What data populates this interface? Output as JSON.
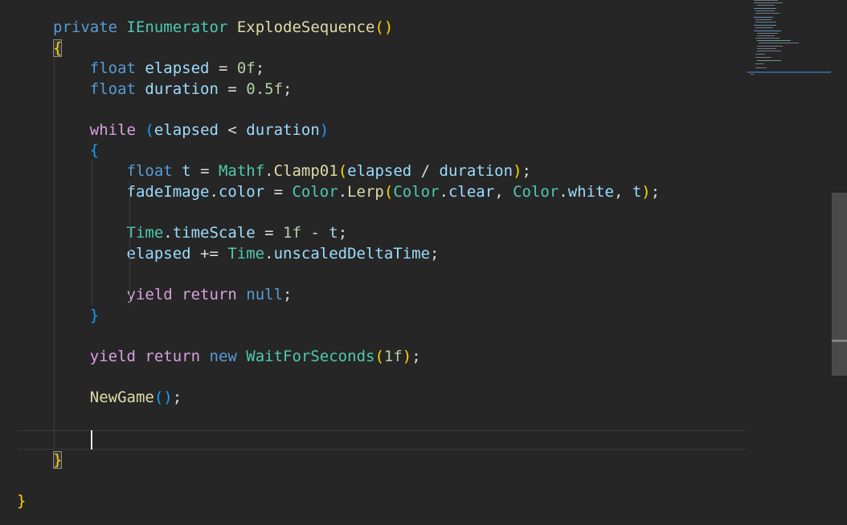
{
  "editor": {
    "lines": [
      {
        "tokens": [
          {
            "t": "private",
            "c": "kw"
          },
          {
            "t": " "
          },
          {
            "t": "IEnumerator",
            "c": "type"
          },
          {
            "t": " "
          },
          {
            "t": "ExplodeSequence",
            "c": "method"
          },
          {
            "t": "()",
            "c": "b1"
          }
        ]
      },
      {
        "tokens": [
          {
            "t": "{",
            "c": "b1 brace-hl"
          }
        ]
      },
      {
        "tokens": [
          {
            "t": "    "
          },
          {
            "t": "float",
            "c": "kw"
          },
          {
            "t": " "
          },
          {
            "t": "elapsed",
            "c": "ident"
          },
          {
            "t": " = "
          },
          {
            "t": "0f",
            "c": "num"
          },
          {
            "t": ";"
          }
        ]
      },
      {
        "tokens": [
          {
            "t": "    "
          },
          {
            "t": "float",
            "c": "kw"
          },
          {
            "t": " "
          },
          {
            "t": "duration",
            "c": "ident"
          },
          {
            "t": " = "
          },
          {
            "t": "0.5f",
            "c": "num"
          },
          {
            "t": ";"
          }
        ]
      },
      {
        "tokens": []
      },
      {
        "tokens": [
          {
            "t": "    "
          },
          {
            "t": "while",
            "c": "kw2"
          },
          {
            "t": " "
          },
          {
            "t": "(",
            "c": "b3"
          },
          {
            "t": "elapsed",
            "c": "ident"
          },
          {
            "t": " < "
          },
          {
            "t": "duration",
            "c": "ident"
          },
          {
            "t": ")",
            "c": "b3"
          }
        ]
      },
      {
        "tokens": [
          {
            "t": "    "
          },
          {
            "t": "{",
            "c": "b3"
          }
        ]
      },
      {
        "tokens": [
          {
            "t": "        "
          },
          {
            "t": "float",
            "c": "kw"
          },
          {
            "t": " "
          },
          {
            "t": "t",
            "c": "ident"
          },
          {
            "t": " = "
          },
          {
            "t": "Mathf",
            "c": "type"
          },
          {
            "t": "."
          },
          {
            "t": "Clamp01",
            "c": "method"
          },
          {
            "t": "(",
            "c": "b1"
          },
          {
            "t": "elapsed",
            "c": "ident"
          },
          {
            "t": " / "
          },
          {
            "t": "duration",
            "c": "ident"
          },
          {
            "t": ")",
            "c": "b1"
          },
          {
            "t": ";"
          }
        ]
      },
      {
        "tokens": [
          {
            "t": "        "
          },
          {
            "t": "fadeImage",
            "c": "ident"
          },
          {
            "t": "."
          },
          {
            "t": "color",
            "c": "ident"
          },
          {
            "t": " = "
          },
          {
            "t": "Color",
            "c": "type"
          },
          {
            "t": "."
          },
          {
            "t": "Lerp",
            "c": "method"
          },
          {
            "t": "(",
            "c": "b1"
          },
          {
            "t": "Color",
            "c": "type"
          },
          {
            "t": "."
          },
          {
            "t": "clear",
            "c": "ident"
          },
          {
            "t": ", "
          },
          {
            "t": "Color",
            "c": "type"
          },
          {
            "t": "."
          },
          {
            "t": "white",
            "c": "ident"
          },
          {
            "t": ", "
          },
          {
            "t": "t",
            "c": "ident"
          },
          {
            "t": ")",
            "c": "b1"
          },
          {
            "t": ";"
          }
        ]
      },
      {
        "tokens": []
      },
      {
        "tokens": [
          {
            "t": "        "
          },
          {
            "t": "Time",
            "c": "type"
          },
          {
            "t": "."
          },
          {
            "t": "timeScale",
            "c": "ident"
          },
          {
            "t": " = "
          },
          {
            "t": "1f",
            "c": "num"
          },
          {
            "t": " - "
          },
          {
            "t": "t",
            "c": "ident"
          },
          {
            "t": ";"
          }
        ]
      },
      {
        "tokens": [
          {
            "t": "        "
          },
          {
            "t": "elapsed",
            "c": "ident"
          },
          {
            "t": " += "
          },
          {
            "t": "Time",
            "c": "type"
          },
          {
            "t": "."
          },
          {
            "t": "unscaledDeltaTime",
            "c": "ident"
          },
          {
            "t": ";"
          }
        ]
      },
      {
        "tokens": []
      },
      {
        "tokens": [
          {
            "t": "        "
          },
          {
            "t": "yield",
            "c": "kw2"
          },
          {
            "t": " "
          },
          {
            "t": "return",
            "c": "kw2"
          },
          {
            "t": " "
          },
          {
            "t": "null",
            "c": "kw"
          },
          {
            "t": ";"
          }
        ]
      },
      {
        "tokens": [
          {
            "t": "    "
          },
          {
            "t": "}",
            "c": "b3"
          }
        ]
      },
      {
        "tokens": []
      },
      {
        "tokens": [
          {
            "t": "    "
          },
          {
            "t": "yield",
            "c": "kw2"
          },
          {
            "t": " "
          },
          {
            "t": "return",
            "c": "kw2"
          },
          {
            "t": " "
          },
          {
            "t": "new",
            "c": "kw"
          },
          {
            "t": " "
          },
          {
            "t": "WaitForSeconds",
            "c": "type"
          },
          {
            "t": "(",
            "c": "b1"
          },
          {
            "t": "1f",
            "c": "num"
          },
          {
            "t": ")",
            "c": "b1"
          },
          {
            "t": ";"
          }
        ]
      },
      {
        "tokens": []
      },
      {
        "tokens": [
          {
            "t": "    "
          },
          {
            "t": "NewGame",
            "c": "method"
          },
          {
            "t": "()",
            "c": "b3"
          },
          {
            "t": ";"
          }
        ]
      },
      {
        "tokens": []
      },
      {
        "tokens": []
      },
      {
        "tokens": [
          {
            "t": "}",
            "c": "b1 brace-hl"
          }
        ]
      },
      {
        "tokens": []
      },
      {
        "tokens": [
          {
            "t": "}",
            "c": "b1"
          }
        ]
      }
    ]
  },
  "theme": {
    "background": "#262626",
    "keyword": "#569cd6",
    "control_keyword": "#d8a0df",
    "type": "#4ec9b0",
    "method": "#dcdcaa",
    "identifier": "#9cdcfe",
    "number": "#b5cea8"
  }
}
